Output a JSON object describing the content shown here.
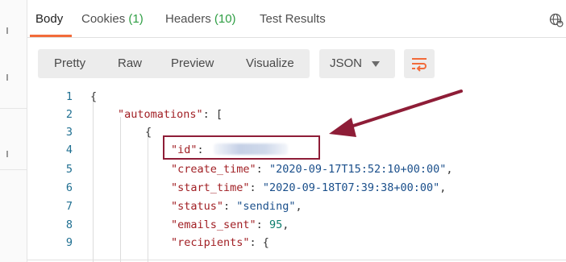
{
  "tabs": [
    {
      "label": "Body",
      "count": ""
    },
    {
      "label": "Cookies",
      "count": "(1)"
    },
    {
      "label": "Headers",
      "count": "(10)"
    },
    {
      "label": "Test Results",
      "count": ""
    }
  ],
  "active_tab": "Body",
  "view_modes": [
    "Pretty",
    "Raw",
    "Preview",
    "Visualize"
  ],
  "format_select": {
    "value": "JSON"
  },
  "icons": {
    "globe": "globe-icon",
    "wrap": "wrap-lines-icon",
    "caret": "chevron-down-icon"
  },
  "colors": {
    "accent": "#f26b3a",
    "highlight_box": "#8e1d37",
    "key": "#a11f24",
    "string": "#1a4f8b",
    "number": "#0c7d6d",
    "count": "#2f9e44"
  },
  "code": {
    "line_numbers": [
      "1",
      "2",
      "3",
      "4",
      "5",
      "6",
      "7",
      "8",
      "9"
    ],
    "l1": {
      "punct": "{"
    },
    "l2": {
      "key": "\"automations\"",
      "punct": ": ["
    },
    "l3": {
      "punct": "{"
    },
    "l4": {
      "key": "\"id\"",
      "punct": ": "
    },
    "l5": {
      "key": "\"create_time\"",
      "sep": ": ",
      "value": "\"2020-09-17T15:52:10+00:00\"",
      "end": ","
    },
    "l6": {
      "key": "\"start_time\"",
      "sep": ": ",
      "value": "\"2020-09-18T07:39:38+00:00\"",
      "end": ","
    },
    "l7": {
      "key": "\"status\"",
      "sep": ": ",
      "value": "\"sending\"",
      "end": ","
    },
    "l8": {
      "key": "\"emails_sent\"",
      "sep": ": ",
      "value": "95",
      "end": ","
    },
    "l9": {
      "key": "\"recipients\"",
      "punct": ": {"
    }
  }
}
